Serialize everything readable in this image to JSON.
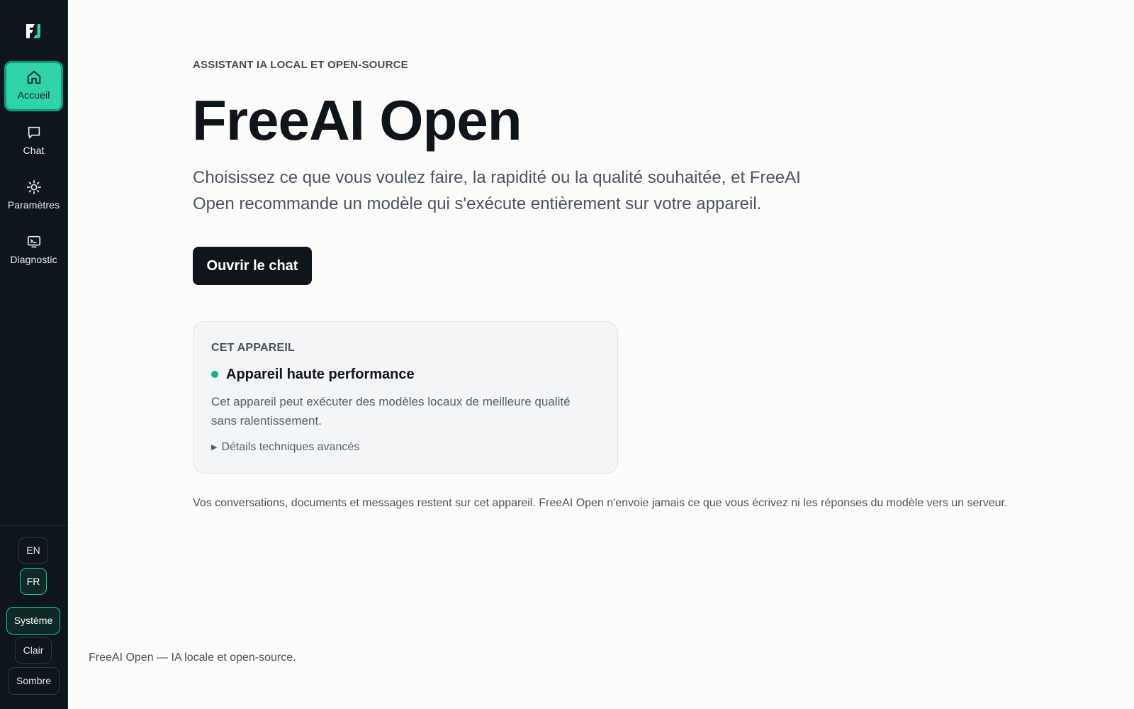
{
  "app": {
    "name": "FreeAI Open"
  },
  "sidebar": {
    "logo": "freeai-logo-icon",
    "items": [
      {
        "label": "Accueil",
        "icon": "home-icon",
        "active": true
      },
      {
        "label": "Chat",
        "icon": "chat-bubble-icon",
        "active": false
      },
      {
        "label": "Paramètres",
        "icon": "gear-icon",
        "active": false
      },
      {
        "label": "Diagnostic",
        "icon": "monitor-terminal-icon",
        "active": false
      }
    ],
    "languages": [
      {
        "label": "EN",
        "selected": false
      },
      {
        "label": "FR",
        "selected": true
      }
    ],
    "themes": [
      {
        "label": "Système",
        "selected": true
      },
      {
        "label": "Clair",
        "selected": false
      },
      {
        "label": "Sombre",
        "selected": false
      }
    ]
  },
  "hero": {
    "eyebrow": "ASSISTANT IA LOCAL ET OPEN-SOURCE",
    "title": "FreeAI Open",
    "subtitle": "Choisissez ce que vous voulez faire, la rapidité ou la qualité souhaitée, et FreeAI Open recommande un modèle qui s'exécute entièrement sur votre appareil.",
    "cta_label": "Ouvrir le chat"
  },
  "device_card": {
    "eyebrow": "CET APPAREIL",
    "heading": "Appareil haute performance",
    "body": "Cet appareil peut exécuter des modèles locaux de meilleure qualité sans ralentissement.",
    "details_label": "Détails techniques avancés"
  },
  "privacy_note": "Vos conversations, documents et messages restent sur cet appareil. FreeAI Open n'envoie jamais ce que vous écrivez ni les réponses du modèle vers un serveur.",
  "footer": "FreeAI Open — IA locale et open-source.",
  "colors": {
    "sidebar_bg": "#0e151d",
    "accent": "#31d3a8",
    "status_dot": "#11b389",
    "page_bg": "#fcfcfb",
    "primary_button": "#0f151b"
  }
}
